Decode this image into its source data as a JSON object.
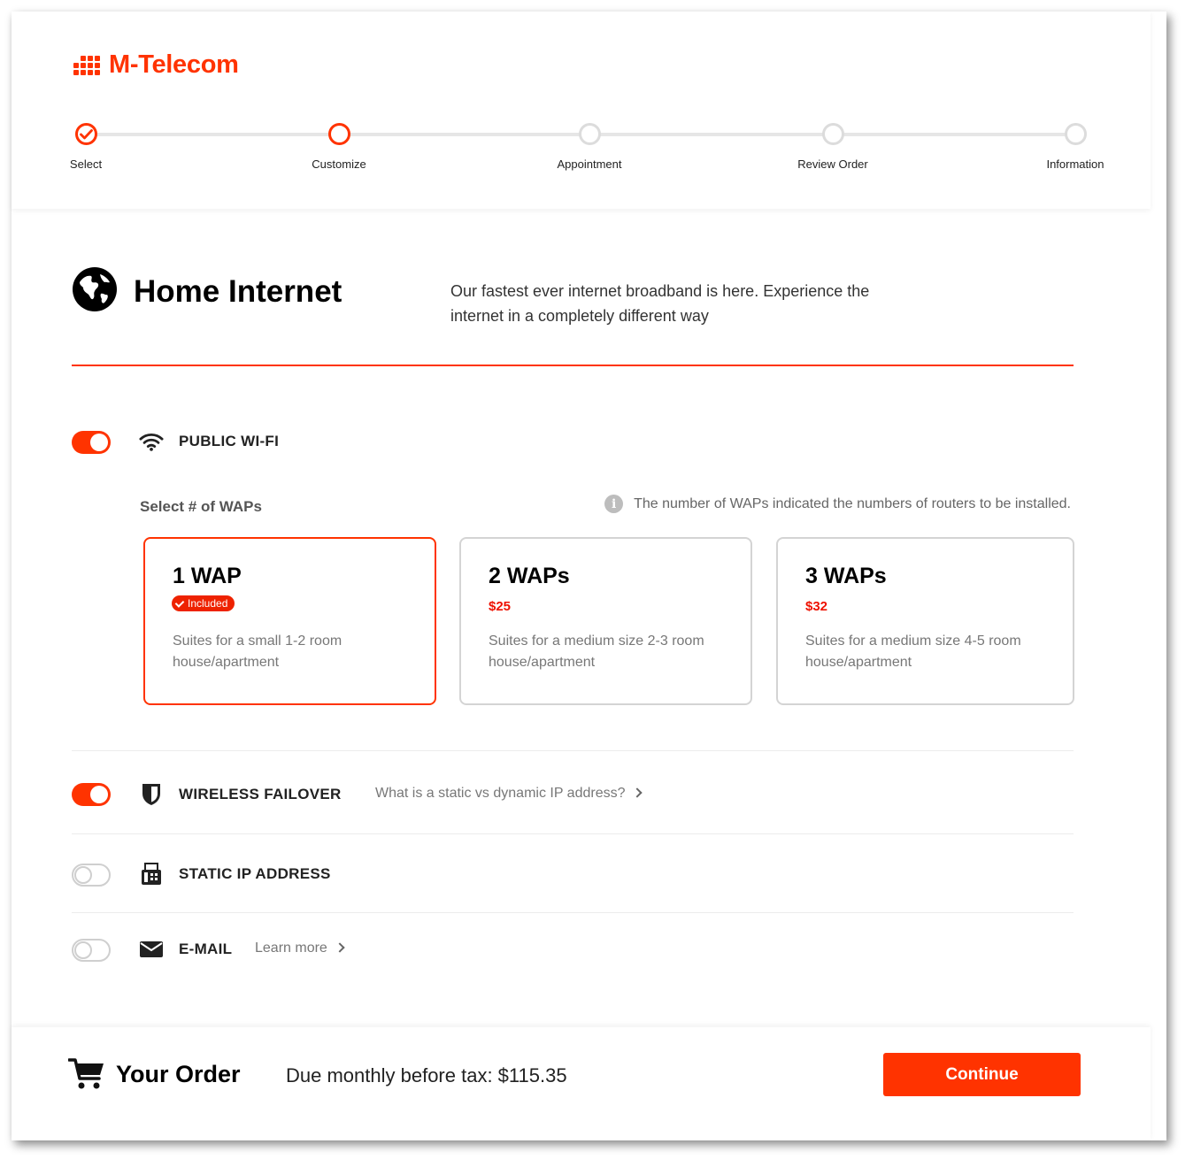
{
  "brand": {
    "name": "M-Telecom",
    "color": "#ff3300"
  },
  "steps": [
    {
      "label": "Select",
      "state": "complete"
    },
    {
      "label": "Customize",
      "state": "active"
    },
    {
      "label": "Appointment",
      "state": "pending"
    },
    {
      "label": "Review Order",
      "state": "pending"
    },
    {
      "label": "Information",
      "state": "pending"
    }
  ],
  "section": {
    "icon": "globe-icon",
    "title": "Home Internet",
    "subtitle": "Our fastest ever internet broadband is here. Experience the internet in a completely different way"
  },
  "options": {
    "public_wifi": {
      "label": "PUBLIC WI-FI",
      "enabled": true,
      "icon": "wifi-icon"
    },
    "wireless_failover": {
      "label": "WIRELESS FAILOVER",
      "enabled": true,
      "icon": "shield-icon",
      "link": "What is a static vs dynamic IP address?"
    },
    "static_ip": {
      "label": "STATIC IP ADDRESS",
      "enabled": false,
      "icon": "fax-icon"
    },
    "email": {
      "label": "E-MAIL",
      "enabled": false,
      "icon": "envelope-icon",
      "link": "Learn more"
    }
  },
  "waps": {
    "select_label": "Select # of WAPs",
    "info_note": "The number of WAPs indicated the numbers of routers to be installed.",
    "cards": [
      {
        "title": "1 WAP",
        "badge": "Included",
        "price": "",
        "description": "Suites for a small 1-2 room house/apartment",
        "selected": true
      },
      {
        "title": "2 WAPs",
        "badge": "",
        "price": "$25",
        "description": "Suites for a medium size 2-3 room house/apartment",
        "selected": false
      },
      {
        "title": "3 WAPs",
        "badge": "",
        "price": "$32",
        "description": "Suites for a medium size 4-5 room house/apartment",
        "selected": false
      }
    ]
  },
  "order": {
    "title": "Your Order",
    "due_text": "Due monthly before tax: $115.35",
    "continue_label": "Continue",
    "icon": "cart-icon"
  }
}
